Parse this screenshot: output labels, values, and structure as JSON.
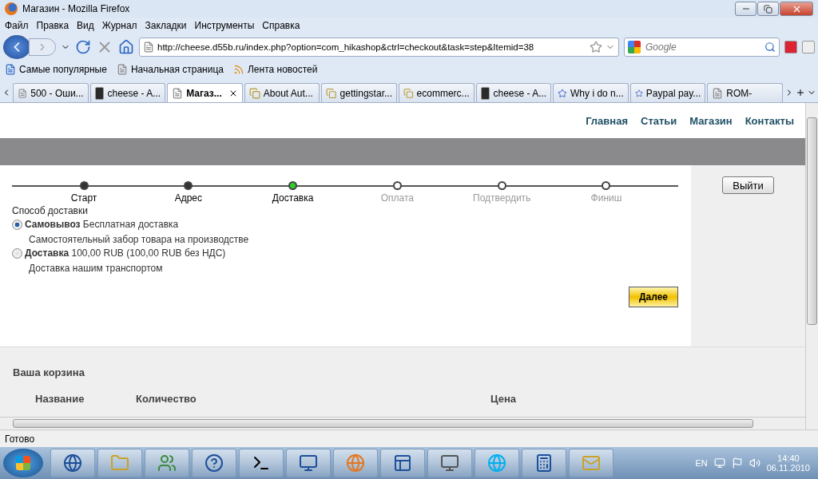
{
  "window": {
    "title": "Магазин - Mozilla Firefox"
  },
  "menu": [
    "Файл",
    "Правка",
    "Вид",
    "Журнал",
    "Закладки",
    "Инструменты",
    "Справка"
  ],
  "address": {
    "value": "http://cheese.d55b.ru/index.php?option=com_hikashop&ctrl=checkout&task=step&Itemid=38"
  },
  "search": {
    "placeholder": "Google"
  },
  "bookmarks": [
    "Самые популярные",
    "Начальная страница",
    "Лента новостей"
  ],
  "tabs": [
    {
      "label": "500 - Оши...",
      "selected": false,
      "kind": "page"
    },
    {
      "label": "cheese - A...",
      "selected": false,
      "kind": "joomla"
    },
    {
      "label": "Магаз...",
      "selected": true,
      "kind": "page"
    },
    {
      "label": "About Aut...",
      "selected": false,
      "kind": "folder"
    },
    {
      "label": "gettingstar...",
      "selected": false,
      "kind": "folder"
    },
    {
      "label": "ecommerc...",
      "selected": false,
      "kind": "folder"
    },
    {
      "label": "cheese - A...",
      "selected": false,
      "kind": "joomla"
    },
    {
      "label": "Why i do n...",
      "selected": false,
      "kind": "star"
    },
    {
      "label": "Paypal pay...",
      "selected": false,
      "kind": "star"
    },
    {
      "label": "ROM-",
      "selected": false,
      "kind": "page"
    }
  ],
  "site_nav": [
    "Главная",
    "Статьи",
    "Магазин",
    "Контакты"
  ],
  "steps": [
    {
      "label": "Старт",
      "kind": "done"
    },
    {
      "label": "Адрес",
      "kind": "done"
    },
    {
      "label": "Доставка",
      "kind": "current"
    },
    {
      "label": "Оплата",
      "kind": "pending"
    },
    {
      "label": "Подтвердить",
      "kind": "pending"
    },
    {
      "label": "Финиш",
      "kind": "pending"
    }
  ],
  "shipping": {
    "heading": "Способ доставки",
    "options": [
      {
        "name": "Самовывоз",
        "price": "Бесплатная доставка",
        "description": "Самостоятельный забор товара на производстве",
        "selected": true
      },
      {
        "name": "Доставка",
        "price": "100,00 RUB (100,00 RUB без НДС)",
        "description": "Доставка нашим транспортом",
        "selected": false
      }
    ]
  },
  "next_button": "Далее",
  "logout_button": "Выйти",
  "cart": {
    "title": "Ваша корзина",
    "columns": [
      "Название",
      "Количество",
      "Цена"
    ]
  },
  "status_bar": "Готово",
  "tray": {
    "language": "EN",
    "time": "14:40",
    "date": "06.11.2010"
  }
}
